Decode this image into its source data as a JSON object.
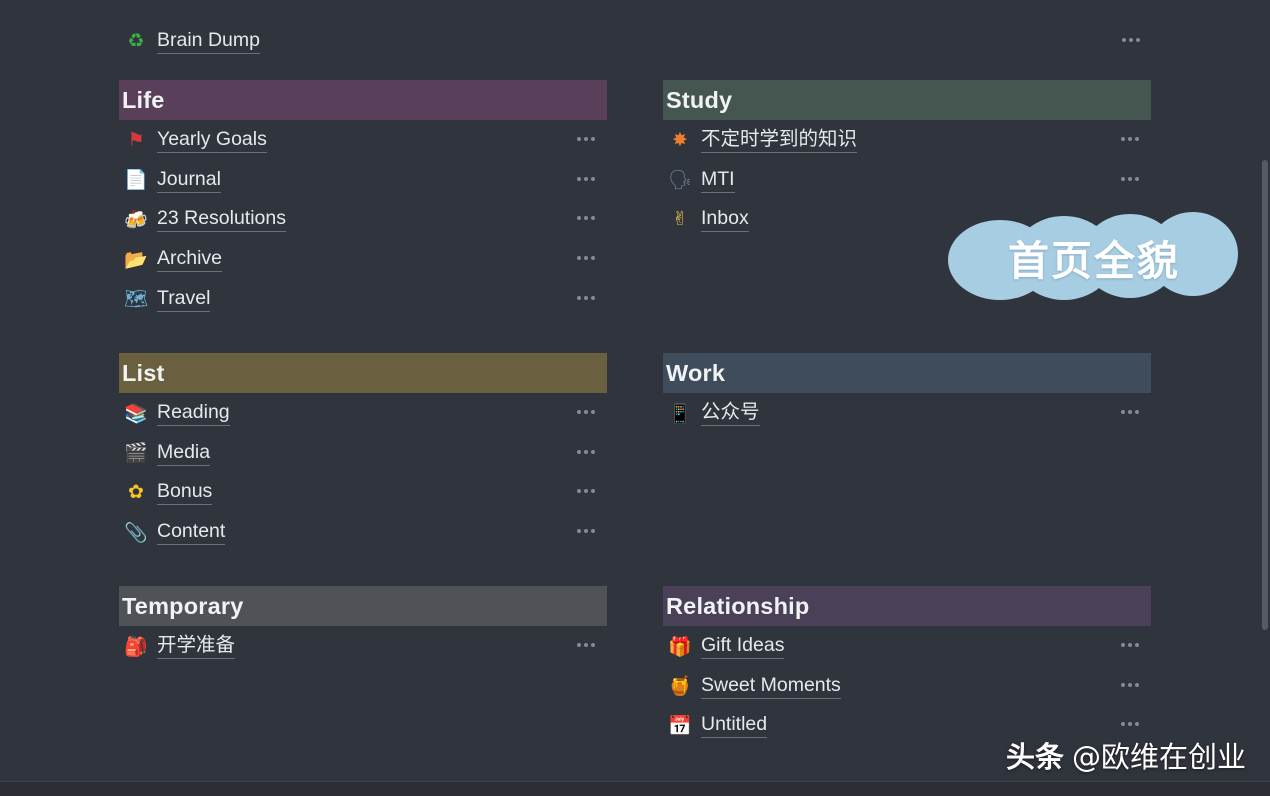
{
  "top_item": {
    "icon": "recycle-icon",
    "glyph": "♻",
    "glyph_color": "#3cae4a",
    "label": "Brain Dump"
  },
  "more_glyph": "•••",
  "sections": [
    {
      "id": "life",
      "title": "Life",
      "color": "#5a3f5a",
      "items": [
        {
          "icon": "red-flag-icon",
          "glyph": "⚑",
          "glyph_color": "#d63b3b",
          "label": "Yearly Goals"
        },
        {
          "icon": "notepad-icon",
          "glyph": "📄",
          "glyph_color": "#dcdcdc",
          "label": "Journal"
        },
        {
          "icon": "beer-mugs-icon",
          "glyph": "🍻",
          "glyph_color": "#e2a43a",
          "label": "23 Resolutions"
        },
        {
          "icon": "folder-icon",
          "glyph": "📂",
          "glyph_color": "#b9bfc7",
          "label": "Archive"
        },
        {
          "icon": "map-icon",
          "glyph": "🗺",
          "glyph_color": "#6ab0d9",
          "label": "Travel"
        }
      ]
    },
    {
      "id": "study",
      "title": "Study",
      "color": "#44564f",
      "items": [
        {
          "icon": "collision-icon",
          "glyph": "✸",
          "glyph_color": "#ef7d2e",
          "label": "不定时学到的知识"
        },
        {
          "icon": "speaking-head-icon",
          "glyph": "🗣",
          "glyph_color": "#6b86a6",
          "label": "MTI"
        },
        {
          "icon": "crossed-fingers-icon",
          "glyph": "✌",
          "glyph_color": "#f2c14e",
          "label": "Inbox"
        }
      ]
    },
    {
      "id": "list",
      "title": "List",
      "color": "#6a5f3e",
      "items": [
        {
          "icon": "books-icon",
          "glyph": "📚",
          "glyph_color": "#6aa55b",
          "label": "Reading"
        },
        {
          "icon": "clapper-board-icon",
          "glyph": "🎬",
          "glyph_color": "#d2d2d2",
          "label": "Media"
        },
        {
          "icon": "sunflower-icon",
          "glyph": "✿",
          "glyph_color": "#f3c623",
          "label": "Bonus"
        },
        {
          "icon": "paperclip-icon",
          "glyph": "📎",
          "glyph_color": "#b8bdc4",
          "label": "Content"
        }
      ]
    },
    {
      "id": "work",
      "title": "Work",
      "color": "#3f4c5b",
      "items": [
        {
          "icon": "mobile-phone-icon",
          "glyph": "📱",
          "glyph_color": "#cfd3d8",
          "label": "公众号"
        }
      ]
    },
    {
      "id": "temporary",
      "title": "Temporary",
      "color": "#4f5257",
      "items": [
        {
          "icon": "backpack-icon",
          "glyph": "🎒",
          "glyph_color": "#d94b3d",
          "label": "开学准备"
        }
      ]
    },
    {
      "id": "relationship",
      "title": "Relationship",
      "color": "#4a4159",
      "items": [
        {
          "icon": "gift-icon",
          "glyph": "🎁",
          "glyph_color": "#e0a63a",
          "label": "Gift Ideas"
        },
        {
          "icon": "honey-pot-icon",
          "glyph": "🍯",
          "glyph_color": "#e9b43c",
          "label": "Sweet Moments"
        },
        {
          "icon": "calendar-icon",
          "glyph": "📅",
          "glyph_color": "#e5e5e5",
          "label": "Untitled"
        }
      ]
    }
  ],
  "overlay": {
    "text": "首页全貌",
    "color": "#a7cde3"
  },
  "watermark": {
    "prefix": "头条",
    "handle": "@欧维在创业"
  }
}
